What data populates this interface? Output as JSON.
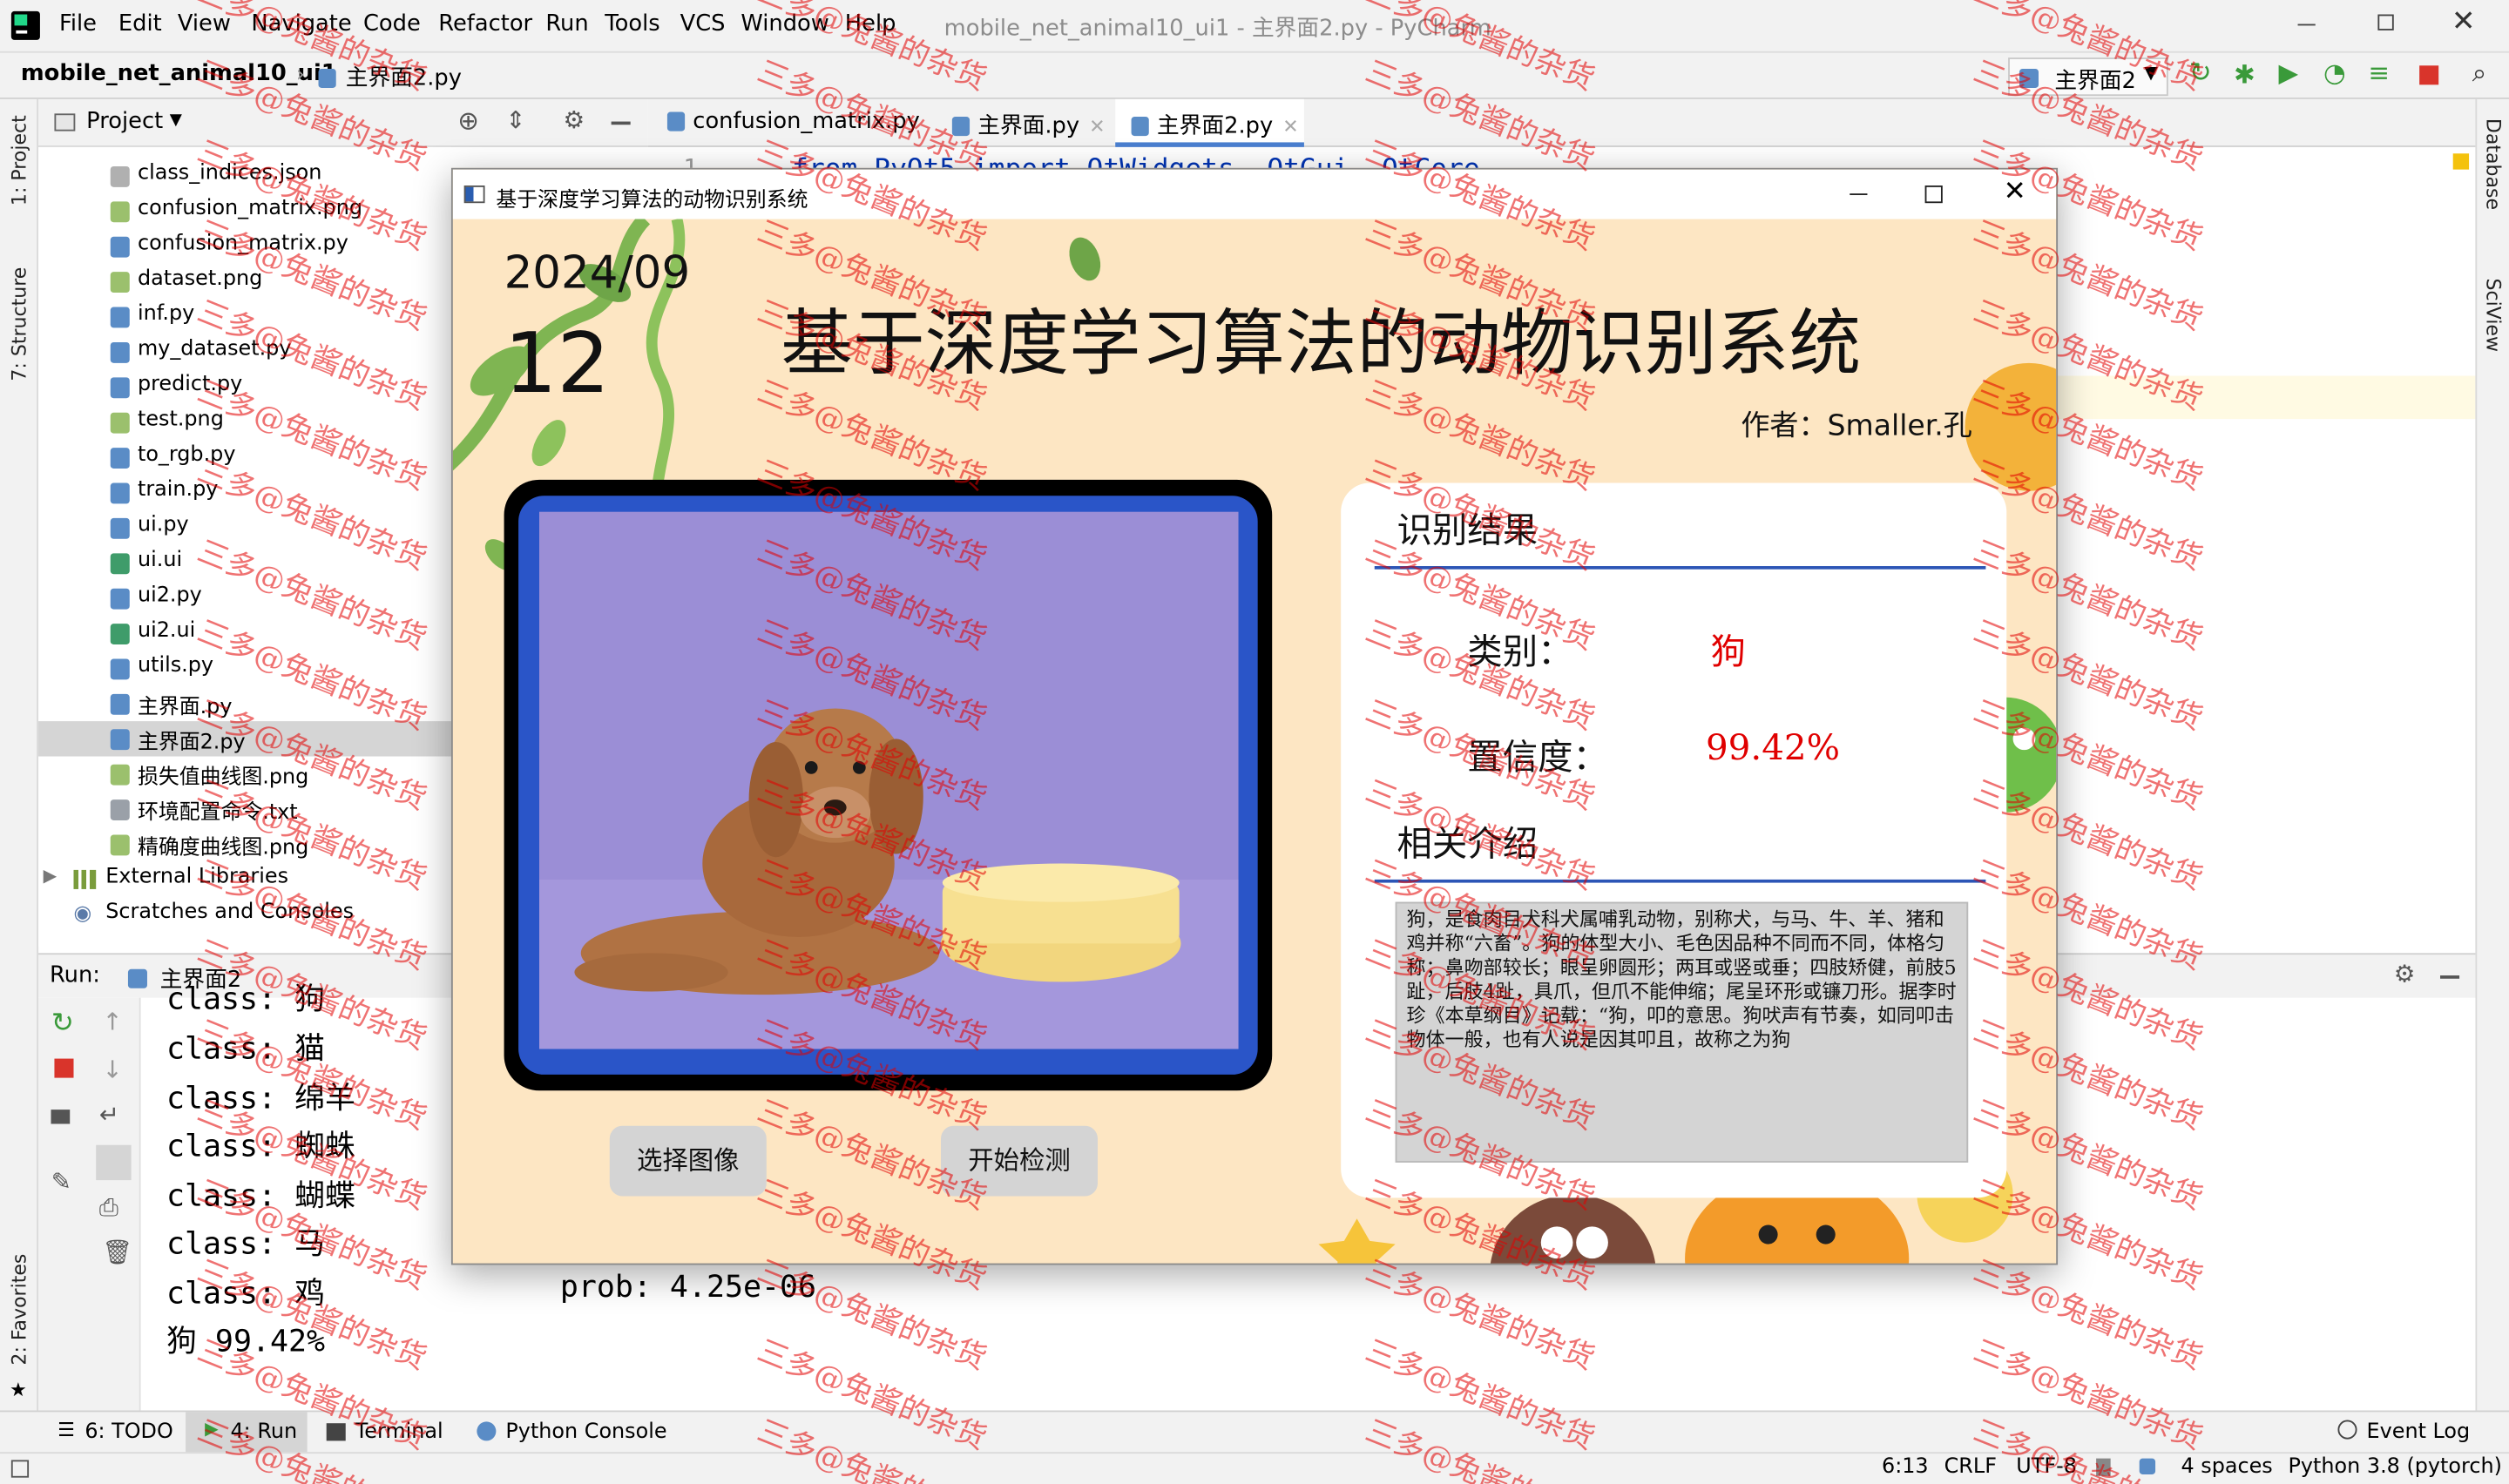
{
  "menu": {
    "items": [
      "File",
      "Edit",
      "View",
      "Navigate",
      "Code",
      "Refactor",
      "Run",
      "Tools",
      "VCS",
      "Window",
      "Help"
    ],
    "title": "mobile_net_animal10_ui1 - 主界面2.py - PyCharm"
  },
  "nav": {
    "project": "mobile_net_animal10_ui1",
    "file": "主界面2.py",
    "run_config": "主界面2"
  },
  "project": {
    "header": "Project",
    "files": [
      "class_indices.json",
      "confusion_matrix.png",
      "confusion_matrix.py",
      "dataset.png",
      "inf.py",
      "my_dataset.py",
      "predict.py",
      "test.png",
      "to_rgb.py",
      "train.py",
      "ui.py",
      "ui.ui",
      "ui2.py",
      "ui2.ui",
      "utils.py",
      "主界面.py",
      "主界面2.py",
      "损失值曲线图.png",
      "环境配置命令.txt",
      "精确度曲线图.png"
    ],
    "external": "External Libraries",
    "scratches": "Scratches and Consoles"
  },
  "editor": {
    "tabs": [
      "confusion_matrix.py",
      "主界面.py",
      "主界面2.py"
    ],
    "line1_number": "1",
    "line1_code": "from PyQt5 import QtWidgets, QtGui, QtCore"
  },
  "sidebar": {
    "project": "1: Project",
    "structure": "7: Structure",
    "favorites": "2: Favorites",
    "database": "Database",
    "sciview": "SciView"
  },
  "run": {
    "label": "Run:",
    "config": "主界面2",
    "lines": [
      "class: 狗",
      "class: 猫",
      "class: 绵羊",
      "class: 蜘蛛",
      "class: 蝴蝶",
      "class: 马",
      "class: 鸡",
      "狗 99.42%"
    ],
    "prob": "prob: 4.25e-06"
  },
  "bottom": {
    "todo": "6: TODO",
    "run": "4: Run",
    "terminal": "Terminal",
    "python_console": "Python Console",
    "event_log": "Event Log"
  },
  "status": {
    "position": "6:13",
    "line_sep": "CRLF",
    "encoding": "UTF-8",
    "indent": "4 spaces",
    "interpreter": "Python 3.8 (pytorch)"
  },
  "app": {
    "window_title": "基于深度学习算法的动物识别系统",
    "date_month": "2024/09",
    "date_day": "12",
    "main_title": "基于深度学习算法的动物识别系统",
    "author": "作者：Smaller.孔",
    "result_header": "识别结果",
    "category_label": "类别：",
    "category_value": "狗",
    "confidence_label": "置信度：",
    "confidence_value": "99.42%",
    "intro_header": "相关介绍",
    "intro_text": "狗，是食肉目犬科犬属哺乳动物，别称犬，与马、牛、羊、猪和鸡并称“六畜”。狗的体型大小、毛色因品种不同而不同，体格匀称；鼻吻部较长；眼呈卵圆形；两耳或竖或垂；四肢矫健，前肢5趾，后肢4趾，具爪，但爪不能伸缩；尾呈环形或镰刀形。据李时珍《本草纲目》记载：“狗，叩的意思。狗吠声有节奏，如同叩击物体一般，也有人说是因其叩且，故称之为狗",
    "select_button": "选择图像",
    "detect_button": "开始检测"
  },
  "watermark": "三多@兔酱的杂货",
  "colors": {
    "accent_red": "#e00000",
    "dialog_bg": "#fde6c3",
    "image_bg": "#9b8ed6",
    "frame_blue": "#2a55c8"
  }
}
